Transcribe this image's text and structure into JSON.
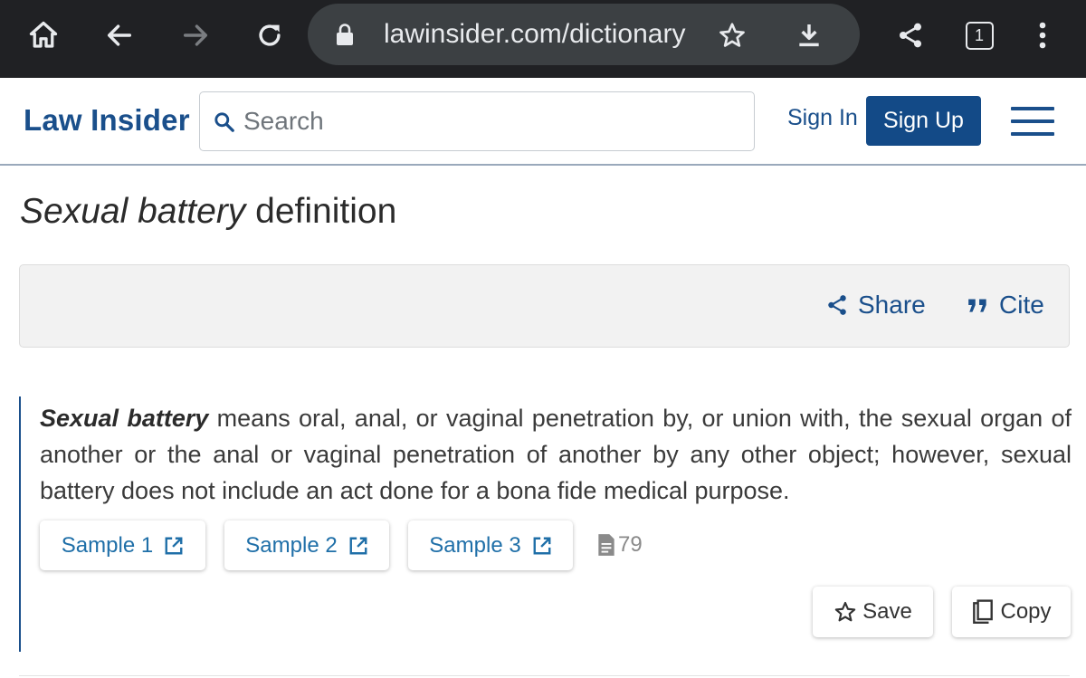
{
  "browser": {
    "url": "lawinsider.com/dictionary",
    "tab_count": "1",
    "icons": [
      "home-icon",
      "back-arrow-icon",
      "forward-arrow-icon",
      "reload-icon",
      "lock-icon",
      "bookmark-star-icon",
      "download-icon",
      "share-icon",
      "tab-switcher-icon",
      "more-vert-icon"
    ]
  },
  "header": {
    "logo": "Law Insider",
    "search_placeholder": "Search",
    "sign_in": "Sign In",
    "sign_up": "Sign Up"
  },
  "page": {
    "title_term": "Sexual battery",
    "title_suffix": " definition"
  },
  "toolbar": {
    "share": "Share",
    "cite": "Cite"
  },
  "definition": {
    "term": "Sexual battery",
    "text": " means oral, anal, or vaginal penetration by, or union with, the sexual organ of another or the anal or vaginal penetration of another by any other object; however, sexual battery does not include an act done for a bona fide medical purpose.",
    "samples": [
      "Sample 1",
      "Sample 2",
      "Sample 3"
    ],
    "document_count": "79"
  },
  "actions": {
    "save": "Save",
    "copy": "Copy"
  },
  "colors": {
    "brand_blue": "#1a4f8b",
    "signup_bg": "#134a87",
    "link_blue": "#1f6fa8",
    "chrome_bg": "#202124"
  }
}
